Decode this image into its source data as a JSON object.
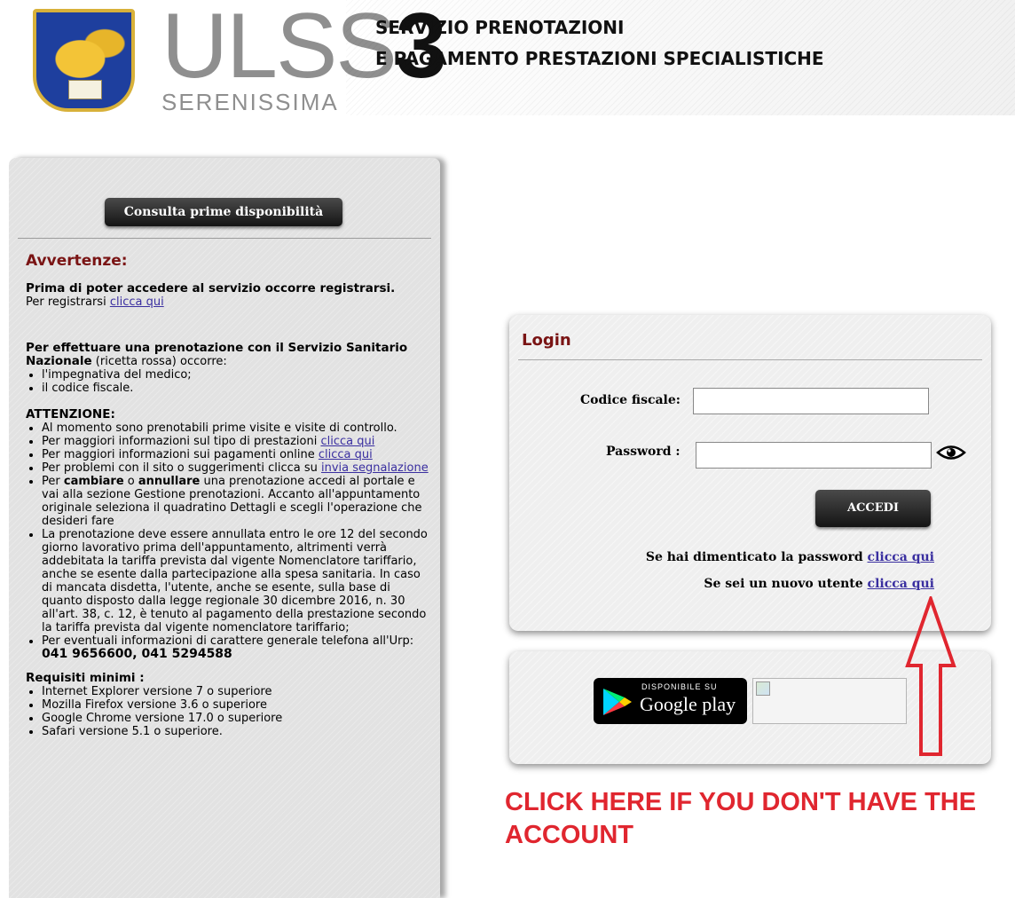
{
  "header": {
    "logo_main_grey": "ULSS",
    "logo_main_dark": "3",
    "logo_sub": "SERENISSIMA",
    "title_line1": "SERVIZIO PRENOTAZIONI",
    "title_line2": "E PAGAMENTO PRESTAZIONI SPECIALISTICHE"
  },
  "left": {
    "consulta_button": "Consulta prime disponibilità",
    "avvertenze_title": "Avvertenze:",
    "register_bold": "Prima di poter accedere al servizio occorre registrarsi.",
    "register_text": "Per registrarsi ",
    "register_link": "clicca qui",
    "prenotazione_bold": "Per effettuare una prenotazione con il Servizio Sanitario Nazionale",
    "prenotazione_rest": " (ricetta rossa) occorre:",
    "requirements": [
      "l'impegnativa del medico;",
      "il codice fiscale."
    ],
    "attenzione_title": "ATTENZIONE:",
    "att_1": "Al momento sono prenotabili prime visite e visite di controllo.",
    "att_2_text": "Per maggiori informazioni sul tipo di prestazioni ",
    "att_2_link": "clicca qui",
    "att_3_text": "Per maggiori informazioni sui pagamenti online ",
    "att_3_link": "clicca qui",
    "att_4_text": "Per problemi con il sito o suggerimenti clicca su ",
    "att_4_link": "invia segnalazione",
    "att_5_a": "Per ",
    "att_5_b1": "cambiare",
    "att_5_c": " o ",
    "att_5_b2": "annullare",
    "att_5_d": " una prenotazione accedi al portale e vai alla sezione Gestione prenotazioni. Accanto all'appuntamento originale seleziona il quadratino Dettagli e scegli l'operazione che desideri fare",
    "att_6": "La prenotazione deve essere annullata entro le ore 12 del secondo giorno lavorativo prima dell'appuntamento, altrimenti verrà addebitata la tariffa prevista dal vigente Nomenclatore tariffario, anche se esente dalla partecipazione alla spesa sanitaria. In caso di mancata disdetta, l'utente, anche se esente, sulla base di quanto disposto dalla legge regionale 30 dicembre 2016, n. 30 all'art. 38, c. 12, è tenuto al pagamento della prestazione secondo la tariffa prevista dal vigente nomenclatore tariffario;",
    "att_7_text": "Per eventuali informazioni di carattere generale telefona all'Urp: ",
    "att_7_phone1": "041 9656600",
    "att_7_sep": ", ",
    "att_7_phone2": "041 5294588",
    "requisiti_title": "Requisiti minimi :",
    "requisiti": [
      "Internet Explorer versione 7 o superiore",
      "Mozilla Firefox versione 3.6 o superiore",
      "Google Chrome versione 17.0 o superiore",
      "Safari versione 5.1 o superiore."
    ]
  },
  "login": {
    "title": "Login",
    "codice_label": "Codice fiscale:",
    "codice_value": "",
    "password_label": "Password :",
    "password_value": "",
    "accedi_button": "ACCEDI",
    "forgot_text": "Se hai dimenticato la password ",
    "forgot_link": "clicca qui",
    "new_user_text": "Se sei un nuovo utente ",
    "new_user_link": "clicca qui"
  },
  "app": {
    "gplay_small": "DISPONIBILE SU",
    "gplay_big": "Google play"
  },
  "annotation": {
    "line1": "CLICK HERE IF YOU DON'T HAVE THE",
    "line2": "ACCOUNT",
    "color": "#e0262f"
  }
}
